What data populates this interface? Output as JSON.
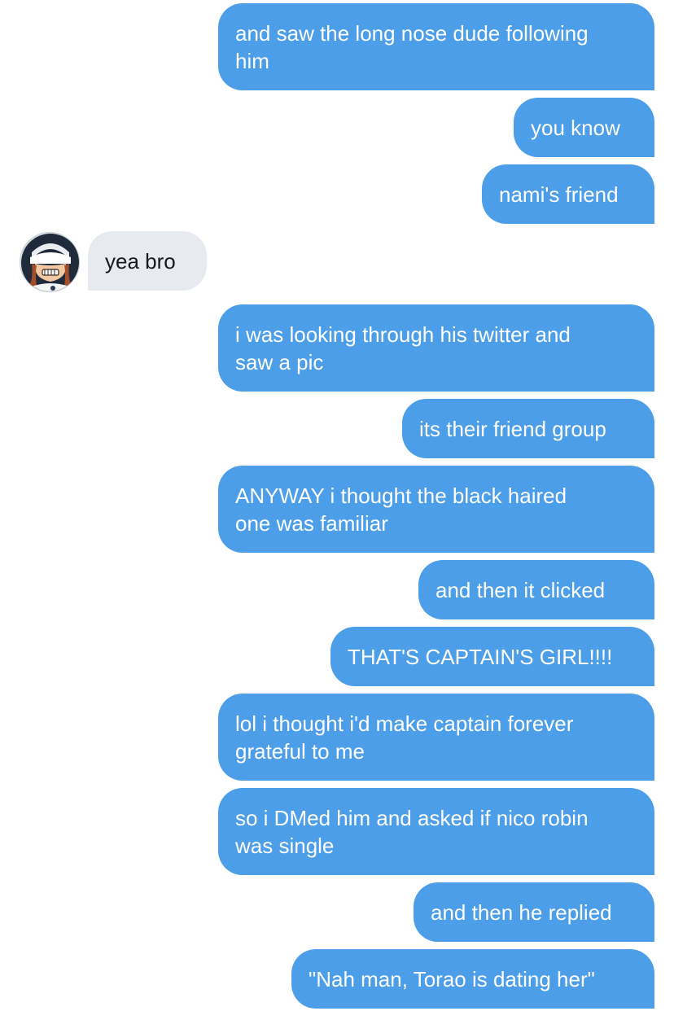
{
  "conversation": {
    "messages": [
      {
        "id": "m1",
        "direction": "outgoing",
        "text_lines": [
          "and saw the long nose dude following",
          "him"
        ]
      },
      {
        "id": "m2",
        "direction": "outgoing",
        "text_lines": [
          "you know"
        ]
      },
      {
        "id": "m3",
        "direction": "outgoing",
        "text_lines": [
          "nami's friend"
        ]
      },
      {
        "id": "m4",
        "direction": "incoming",
        "text_lines": [
          "yea bro"
        ]
      },
      {
        "id": "m5",
        "direction": "outgoing",
        "text_lines": [
          "i was looking through his twitter and",
          "saw a pic"
        ]
      },
      {
        "id": "m6",
        "direction": "outgoing",
        "text_lines": [
          "its their friend group"
        ]
      },
      {
        "id": "m7",
        "direction": "outgoing",
        "text_lines": [
          "ANYWAY i thought the black haired",
          "one was familiar"
        ]
      },
      {
        "id": "m8",
        "direction": "outgoing",
        "text_lines": [
          "and then it clicked"
        ]
      },
      {
        "id": "m9",
        "direction": "outgoing",
        "text_lines": [
          "THAT'S CAPTAIN'S GIRL!!!!"
        ]
      },
      {
        "id": "m10",
        "direction": "outgoing",
        "text_lines": [
          "lol i thought i'd make captain forever",
          "grateful to me"
        ]
      },
      {
        "id": "m11",
        "direction": "outgoing",
        "text_lines": [
          "so i DMed him and asked if nico robin",
          "was single"
        ]
      },
      {
        "id": "m12",
        "direction": "outgoing",
        "text_lines": [
          "and then he replied"
        ]
      },
      {
        "id": "m13",
        "direction": "outgoing",
        "text_lines": [
          "\"Nah man, Torao is dating her\""
        ]
      }
    ]
  },
  "colors": {
    "outgoing_bubble": "#4c9ee8",
    "incoming_bubble": "#e7ebef",
    "outgoing_text": "#ffffff",
    "incoming_text": "#15181c",
    "background": "#ffffff"
  },
  "icons": {
    "sender_avatar": "avatar-illustration"
  }
}
